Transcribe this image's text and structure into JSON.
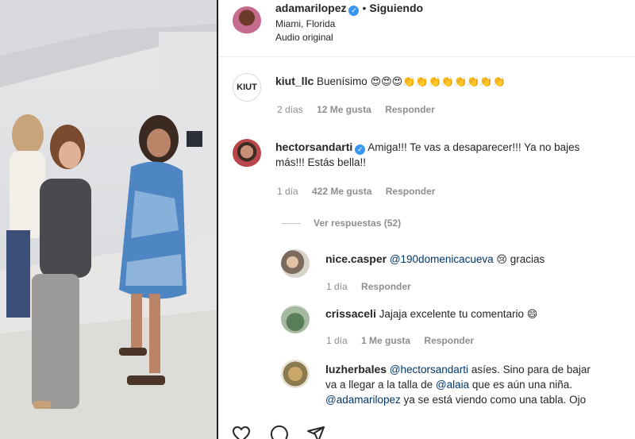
{
  "post": {
    "username": "adamarilopez",
    "dot": "•",
    "follow_status": "Siguiendo",
    "location": "Miami, Florida",
    "audio": "Audio original"
  },
  "comments": [
    {
      "username": "kiut_llc",
      "avatar_text": "KIUT",
      "text": "Buenísimo",
      "emoji": "😍😍😍👏👏👏👏👏👏👏👏",
      "time": "2 días",
      "likes": "12 Me gusta",
      "reply": "Responder"
    },
    {
      "username": "hectorsandarti",
      "text_line1": "Amiga!!! Te vas a desaparecer!!! Ya no bajes",
      "text_line2": "más!!! Estás bella!!",
      "time": "1 día",
      "likes": "422 Me gusta",
      "reply": "Responder",
      "view_replies": "Ver respuestas (52)"
    }
  ],
  "replies": [
    {
      "username": "nice.casper",
      "mention": "@190domenicacueva",
      "text": "gracias",
      "emoji": "😢",
      "time": "1 día",
      "reply": "Responder"
    },
    {
      "username": "crissaceli",
      "text": "Jajaja excelente tu comentario",
      "emoji": "😄",
      "time": "1 día",
      "likes": "1 Me gusta",
      "reply": "Responder"
    },
    {
      "username": "luzherbales",
      "mention1": "@hectorsandarti",
      "text1": "asíes. Sino para de bajar",
      "text2a": "va a llegar a la talla de",
      "mention2": "@alaia",
      "text2b": "que es aún una niña.",
      "mention3": "@adamarilopez",
      "text3": "ya se está viendo como una tabla. Ojo"
    }
  ],
  "icons": [
    "heart-icon",
    "comment-icon",
    "share-icon"
  ],
  "colors": {
    "verified": "#3897f0",
    "muted": "#8e8e8e",
    "mention": "#00376b"
  }
}
